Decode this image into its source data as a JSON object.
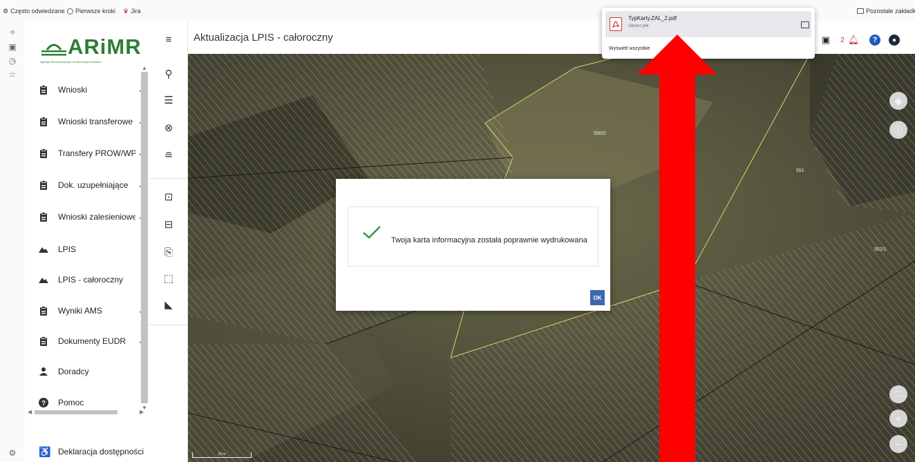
{
  "bookmarks": {
    "items": [
      "Często odwiedzane",
      "Pierwsze kroki",
      "Jira"
    ],
    "other": "Pozostałe zakładki"
  },
  "logo": {
    "name": "ARiMR",
    "subtitle": "Agencja Restrukturyzacji i Modernizacji Rolnictwa"
  },
  "sidebar": {
    "items": [
      {
        "label": "Wnioski",
        "icon": "clipboard-icon",
        "chevron": true
      },
      {
        "label": "Wnioski transferowe",
        "icon": "clipboard-icon",
        "chevron": true
      },
      {
        "label": "Transfery PROW/WPR",
        "icon": "clipboard-icon",
        "chevron": true
      },
      {
        "label": "Dok. uzupełniające",
        "icon": "clipboard-icon",
        "chevron": true
      },
      {
        "label": "Wnioski zalesieniowe",
        "icon": "clipboard-icon",
        "chevron": true
      },
      {
        "label": "LPIS",
        "icon": "mountain-icon",
        "chevron": false
      },
      {
        "label": "LPIS - całoroczny",
        "icon": "mountain-icon",
        "chevron": false
      },
      {
        "label": "Wyniki AMS",
        "icon": "clipboard-icon",
        "chevron": true
      },
      {
        "label": "Dokumenty EUDR",
        "icon": "clipboard-icon",
        "chevron": true
      },
      {
        "label": "Doradcy",
        "icon": "person-icon",
        "chevron": false
      },
      {
        "label": "Pomoc",
        "icon": "help-icon",
        "chevron": false
      }
    ],
    "footer": "Deklaracja dostępności"
  },
  "header": {
    "title": "Aktualizacja LPIS - całoroczny",
    "notification_count": "2"
  },
  "map": {
    "parcels": [
      "550/2",
      "551",
      "552/1"
    ],
    "scale": "20 m"
  },
  "modal": {
    "message": "Twoja karta informacyjna została poprawnie wydrukowana",
    "ok_label": "OK"
  },
  "download": {
    "file_name": "TypKarty.ZAL_2.pdf",
    "action": "Otwórz plik",
    "show_all": "Wyświetl wszystkie"
  },
  "colors": {
    "brand_green": "#2e7d32",
    "ok_blue": "#3f67b0",
    "arrow_red": "#ff0000",
    "bell_red": "#c62828",
    "help_blue": "#1e5bb8"
  }
}
